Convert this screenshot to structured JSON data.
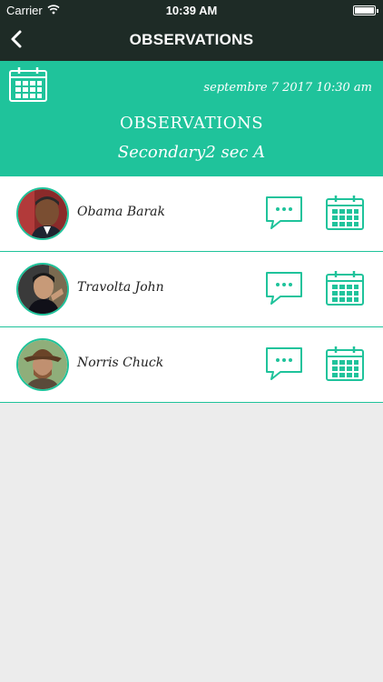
{
  "status_bar": {
    "carrier": "Carrier",
    "time": "10:39 AM"
  },
  "nav": {
    "title": "OBSERVATIONS",
    "back_icon": "chevron-left-icon"
  },
  "header": {
    "date": "septembre 7 2017 10:30 am",
    "title": "OBSERVATIONS",
    "subtitle": "Secondary2 sec A",
    "calendar_icon": "calendar-icon"
  },
  "students": [
    {
      "name": "Obama Barak"
    },
    {
      "name": "Travolta John"
    },
    {
      "name": "Norris Chuck"
    }
  ],
  "colors": {
    "accent": "#1fc39b",
    "nav_bg": "#1e2b26",
    "page_bg": "#ececec"
  }
}
